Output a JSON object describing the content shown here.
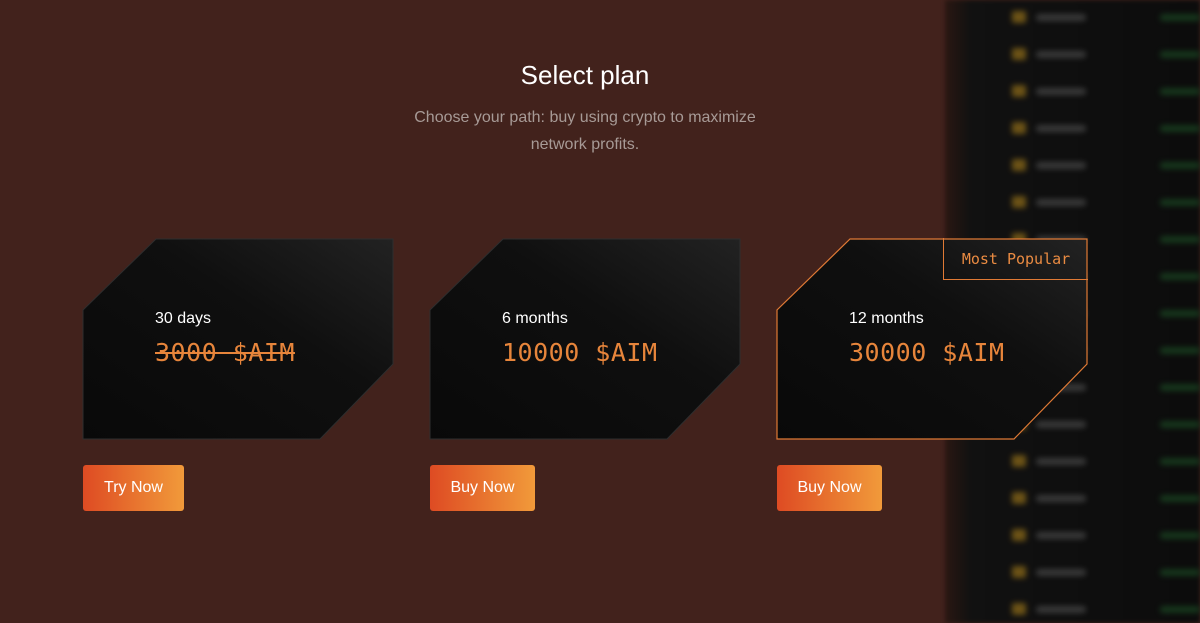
{
  "header": {
    "title": "Select plan",
    "subtitle": "Choose your path: buy using crypto to maximize network profits."
  },
  "plans": [
    {
      "term": "30 days",
      "price": "3000 $AIM",
      "price_struck": true,
      "button": "Try Now",
      "highlighted": false
    },
    {
      "term": "6 months",
      "price": "10000 $AIM",
      "price_struck": false,
      "button": "Buy Now",
      "highlighted": false
    },
    {
      "term": "12 months",
      "price": "30000 $AIM",
      "price_struck": false,
      "button": "Buy Now",
      "highlighted": true,
      "badge": "Most Popular"
    }
  ],
  "colors": {
    "background": "#42221c",
    "accent": "#e7853b",
    "button_gradient_start": "#de4b23",
    "button_gradient_end": "#f19a3a",
    "card": "#0c0c0c"
  }
}
